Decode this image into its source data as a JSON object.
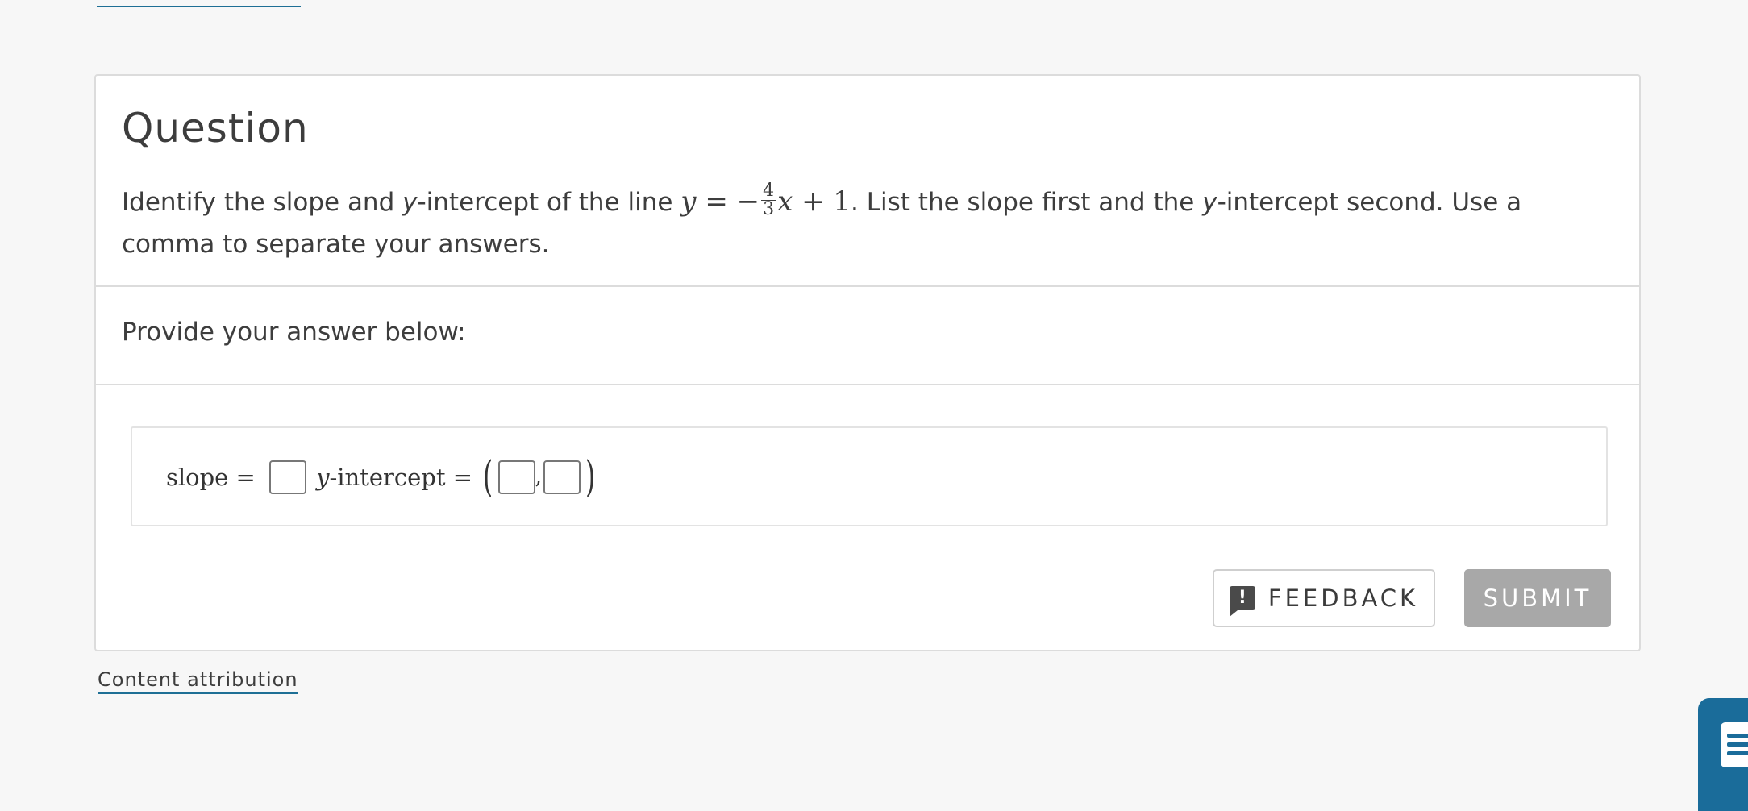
{
  "question": {
    "title": "Question",
    "text_before": "Identify the slope and ",
    "y_var": "y",
    "text_mid": "-intercept of the line ",
    "eq_y": "y",
    "eq_equals_minus": " = −",
    "frac_num": "4",
    "frac_den": "3",
    "eq_x": "x",
    "eq_plus_one": " + 1",
    "text_after": ". List the slope first and the ",
    "y_var_2": "y",
    "text_end": "-intercept second. Use a comma to separate your answers."
  },
  "answer": {
    "prompt": "Provide your answer below:",
    "slope_label": "slope = ",
    "y_label_var": "y",
    "intercept_label": "-intercept = ",
    "open_paren": "(",
    "comma": ",",
    "close_paren": ")"
  },
  "buttons": {
    "feedback_label": "FEEDBACK",
    "feedback_icon_glyph": "!",
    "submit_label": "SUBMIT"
  },
  "footer": {
    "attribution": "Content attribution"
  },
  "colors": {
    "accent": "#1a6c9a",
    "submit_disabled": "#a8a8a8"
  }
}
